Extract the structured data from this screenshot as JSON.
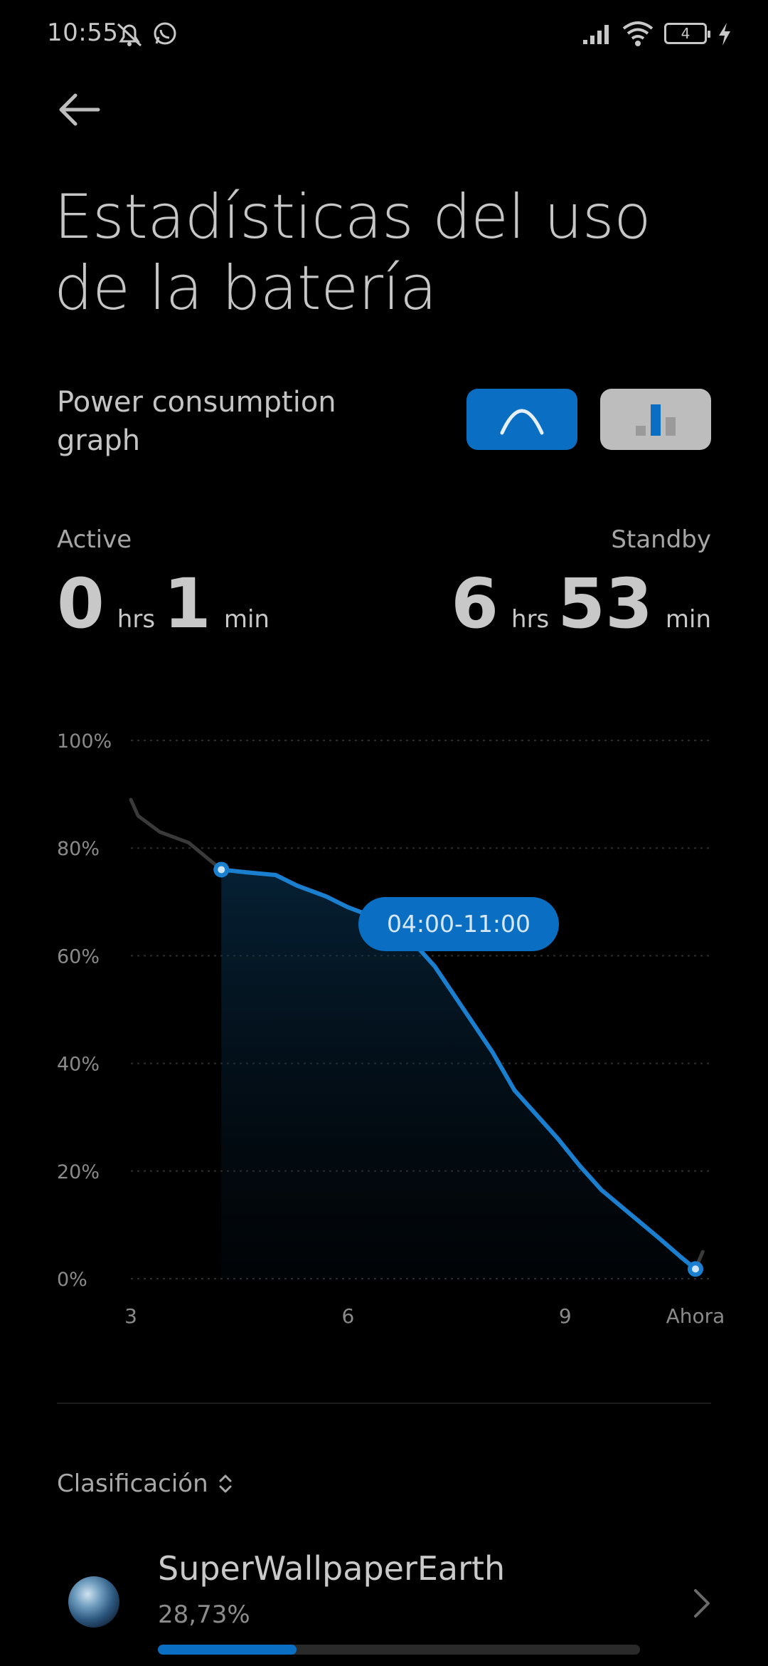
{
  "status_bar": {
    "time": "10:55",
    "battery_level": "4",
    "icons": [
      "muted-bell-icon",
      "whatsapp-icon",
      "signal-icon",
      "wifi-icon",
      "battery-icon",
      "charging-bolt-icon"
    ]
  },
  "header": {
    "back_icon": "arrow-left-icon",
    "title": "Estadísticas del uso de la batería"
  },
  "graph_section": {
    "label": "Power consumption graph",
    "toggle_curve_icon": "curve-icon",
    "toggle_bars_icon": "bar-chart-icon",
    "selected_toggle": "curve"
  },
  "stats": {
    "active": {
      "label": "Active",
      "hours": "0",
      "hours_unit": "hrs",
      "minutes": "1",
      "minutes_unit": "min"
    },
    "standby": {
      "label": "Standby",
      "hours": "6",
      "hours_unit": "hrs",
      "minutes": "53",
      "minutes_unit": "min"
    }
  },
  "selection": {
    "range_label": "04:00-11:00"
  },
  "chart_data": {
    "type": "area",
    "ylim": [
      0,
      100
    ],
    "y_ticks": [
      "100%",
      "80%",
      "60%",
      "40%",
      "20%",
      "0%"
    ],
    "x_ticks": [
      "3",
      "6",
      "9",
      "Ahora"
    ],
    "x_tick_values": [
      3,
      6,
      9,
      10.8
    ],
    "grid": true,
    "highlight_range": [
      4.25,
      10.8
    ],
    "series": [
      {
        "x": [
          3.0,
          3.1,
          3.4,
          3.8,
          4.25,
          4.6,
          5.0,
          5.3,
          5.7,
          6.0,
          6.5,
          7.0,
          7.2,
          7.6,
          8.0,
          8.3,
          8.6,
          8.9,
          9.2,
          9.5,
          9.9,
          10.3,
          10.6,
          10.8,
          10.9
        ],
        "values": [
          89,
          86,
          83,
          81,
          76,
          75.5,
          75,
          73,
          71,
          69,
          66.5,
          61,
          58,
          50,
          42,
          35,
          30.5,
          26,
          21,
          16.5,
          12,
          7.5,
          4,
          1.8,
          5
        ]
      }
    ]
  },
  "sort": {
    "label": "Clasificación",
    "icon": "sort-chevrons-icon"
  },
  "apps": [
    {
      "name": "SuperWallpaperEarth",
      "percent_text": "28,73%",
      "percent_value": 28.73,
      "icon": "earth-icon",
      "chevron": "chevron-right-icon"
    }
  ],
  "colors": {
    "accent": "#0a6fc2",
    "line": "#1a7fcf",
    "background": "#000000",
    "muted_line": "#3a3a3a"
  }
}
